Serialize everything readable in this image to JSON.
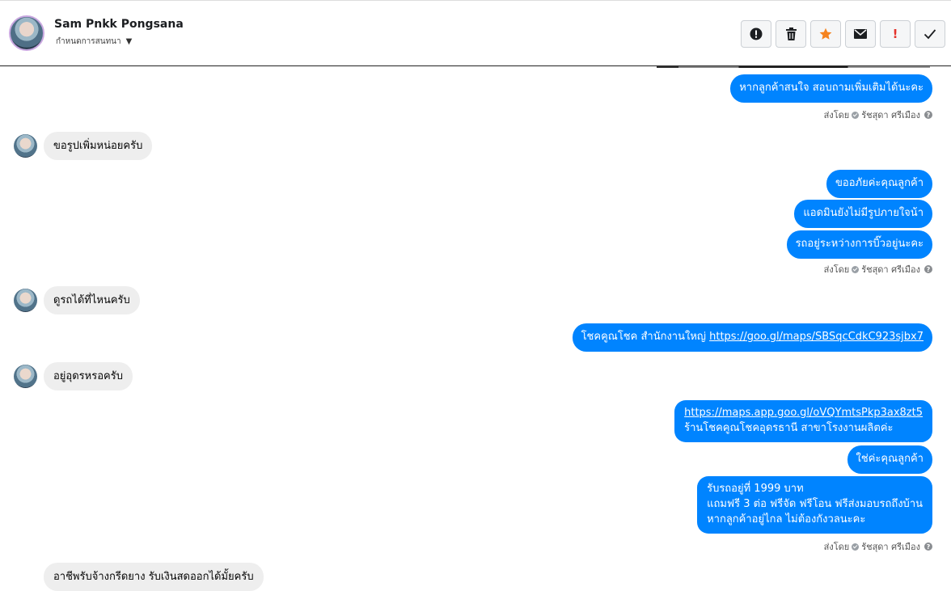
{
  "header": {
    "name": "Sam Pnkk Pongsana",
    "subtitle": "กำหนดการสนทนา"
  },
  "toolbar": {
    "icons": [
      "alert-circle-icon",
      "trash-icon",
      "star-icon",
      "envelope-icon",
      "exclamation-icon",
      "check-icon"
    ],
    "exclaim_text": "!"
  },
  "colors": {
    "outgoing": "#0084ff",
    "incoming": "#eeeeee",
    "star": "#f5831f",
    "exclaim": "#e4322b"
  },
  "messages": {
    "m1": "หากลูกค้าสนใจ สอบถามเพิ่มเติมได้นะคะ",
    "m2": "ขอรูปเพิ่มหน่อยครับ",
    "m3": "ขออภัยค่ะคุณลูกค้า",
    "m4": "แอดมินยังไม่มีรูปภายใจน้า",
    "m5": "รถอยู่ระหว่างการบิ๊วอยู่นะคะ",
    "m6": "ดูรถได้ที่ไหนครับ",
    "m7_text": "โชคคูณโชค สำนักงานใหญ่ ",
    "m7_link": "https://goo.gl/maps/SBSqcCdkC923sjbx7",
    "m8": "อยู่อุดรหรอครับ",
    "m9_link": "https://maps.app.goo.gl/oVQYmtsPkp3ax8zt5",
    "m9_text": "ร้านโชคคูณโชคอุดรธานี สาขาโรงงานผลิตค่ะ",
    "m10": "ใช่ค่ะคุณลูกค้า",
    "m11_l1": "รับรถอยู่ที่ 1999 บาท",
    "m11_l2": "แถมฟรี 3 ต่อ ฟรีจัด ฟรีโอน  ฟรีส่งมอบรถถึงบ้าน",
    "m11_l3": "หากลูกค้าอยู่ไกล ไม่ต้องกังวลนะคะ",
    "m12": "อาชีพรับจ้างกรีดยาง รับเงินสดออกได้มั้ยครับ"
  },
  "sent_by": {
    "prefix": "ส่งโดย",
    "agent": "รัชสุดา ศรีเมือง",
    "help": "?"
  }
}
